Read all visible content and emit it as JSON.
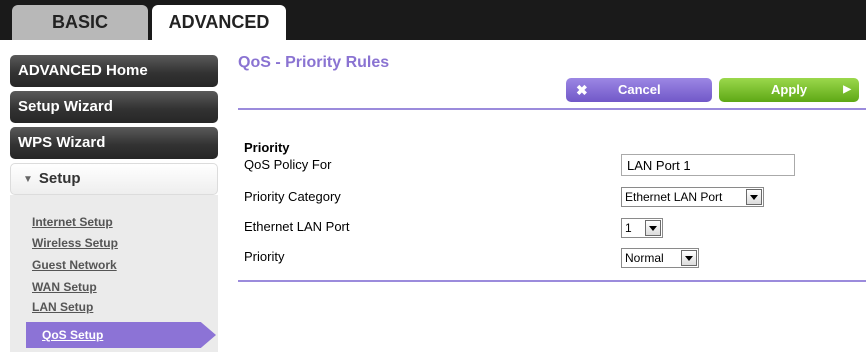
{
  "tabs": {
    "basic": "BASIC",
    "advanced": "ADVANCED"
  },
  "sidebar": {
    "advanced_home": "ADVANCED Home",
    "setup_wizard": "Setup Wizard",
    "wps_wizard": "WPS Wizard",
    "setup": "Setup",
    "setup_items": [
      "Internet Setup",
      "Wireless Setup",
      "Guest Network",
      "WAN Setup",
      "LAN Setup"
    ],
    "active_item": "QoS Setup"
  },
  "main": {
    "title": "QoS - Priority Rules",
    "cancel_label": "Cancel",
    "apply_label": "Apply",
    "section_heading": "Priority",
    "fields": {
      "policy_label": "QoS Policy For",
      "policy_value": "LAN Port 1",
      "category_label": "Priority Category",
      "category_value": "Ethernet LAN Port",
      "port_label": "Ethernet LAN Port",
      "port_value": "1",
      "priority_label": "Priority",
      "priority_value": "Normal"
    }
  },
  "colors": {
    "accent_purple": "#8a73d2",
    "apply_green": "#6cb520",
    "nav_dark": "#333333"
  },
  "icons": [
    "close-icon",
    "arrow-right-icon",
    "chevron-down-icon",
    "dropdown-arrow-icon"
  ]
}
